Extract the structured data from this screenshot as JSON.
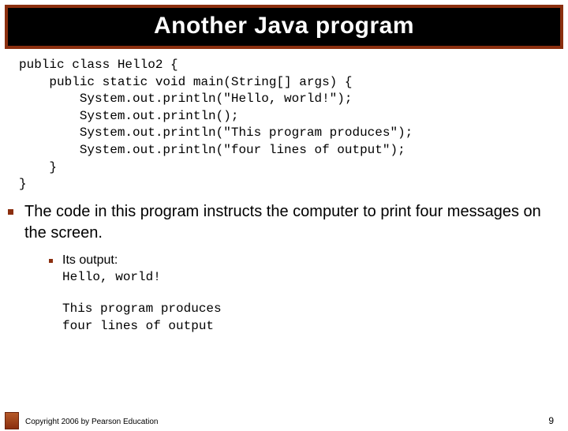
{
  "title": "Another Java program",
  "code": "public class Hello2 {\n    public static void main(String[] args) {\n        System.out.println(\"Hello, world!\");\n        System.out.println();\n        System.out.println(\"This program produces\");\n        System.out.println(\"four lines of output\");\n    }\n}",
  "body_text": "The code in this program instructs the computer to print four messages on the screen.",
  "sub_label": "Its output:",
  "output_first": "Hello, world!",
  "output_rest": "This program produces\nfour lines of output",
  "copyright": "Copyright 2006 by Pearson Education",
  "page_number": "9"
}
